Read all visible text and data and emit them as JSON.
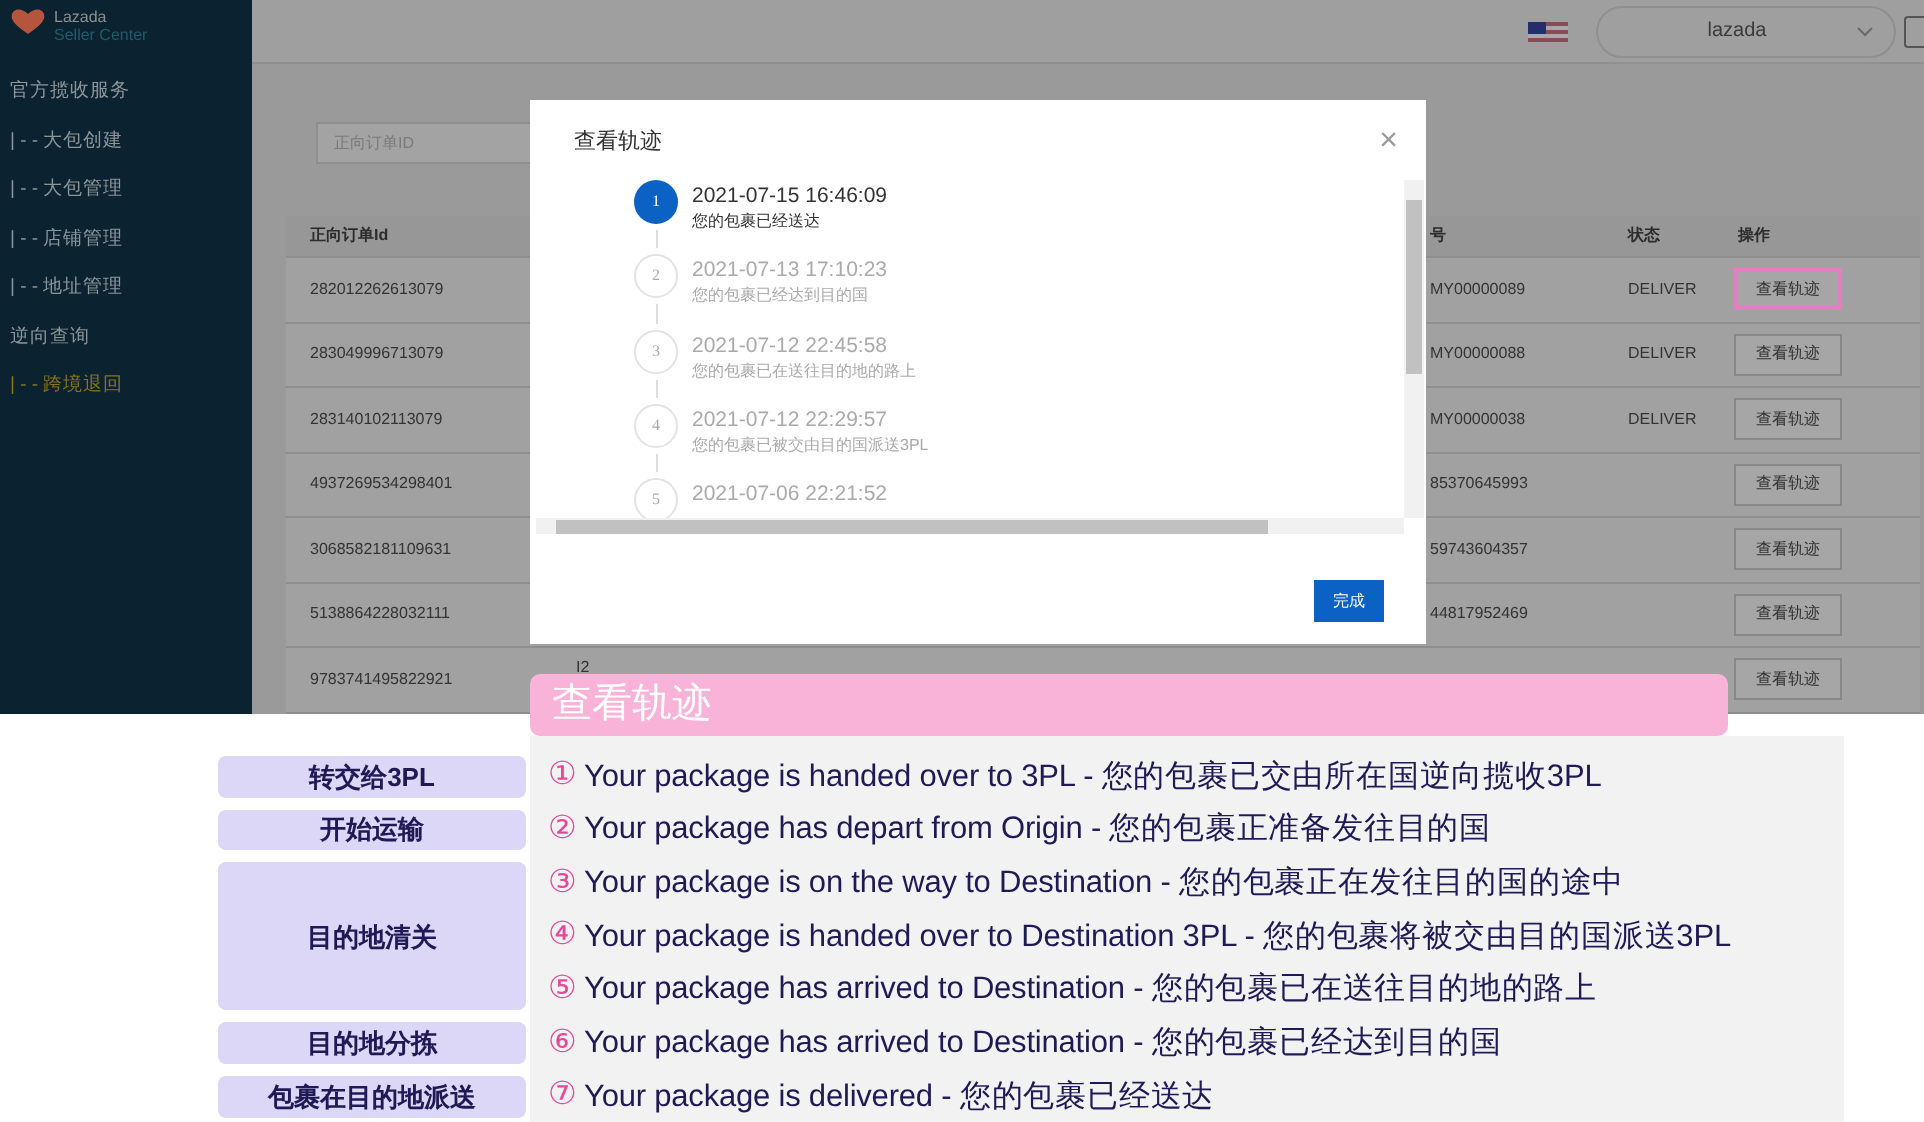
{
  "sidebar": {
    "brand": "Lazada",
    "subtitle": "Seller Center",
    "items": [
      {
        "label": "官方揽收服务",
        "selected": false
      },
      {
        "label": "| - - 大包创建",
        "selected": false
      },
      {
        "label": "| - - 大包管理",
        "selected": false
      },
      {
        "label": "| - - 店铺管理",
        "selected": false
      },
      {
        "label": "| - - 地址管理",
        "selected": false
      },
      {
        "label": "逆向查询",
        "selected": false
      },
      {
        "label": "| - - 跨境退回",
        "selected": true
      }
    ]
  },
  "top_bar": {
    "account": "lazada"
  },
  "search": {
    "placeholder": "正向订单ID"
  },
  "table": {
    "columns": [
      "正向订单Id",
      "号",
      "状态",
      "操作"
    ],
    "rows": [
      {
        "order_id": "282012262613079",
        "column_2": "MY00000089",
        "status": "DELIVER",
        "action": "查看轨迹",
        "highlighted": true
      },
      {
        "order_id": "283049996713079",
        "column_2": "MY00000088",
        "status": "DELIVER",
        "action": "查看轨迹",
        "highlighted": false
      },
      {
        "order_id": "283140102113079",
        "column_2": "MY00000038",
        "status": "DELIVER",
        "action": "查看轨迹",
        "highlighted": false
      },
      {
        "order_id": "4937269534298401",
        "column_2": "85370645993",
        "action": "查看轨迹",
        "highlighted": false
      },
      {
        "order_id": "3068582181109631",
        "column_2": "59743604357",
        "action": "查看轨迹",
        "highlighted": false
      },
      {
        "order_id": "5138864228032111",
        "column_2": "44817952469",
        "action": "查看轨迹",
        "highlighted": false
      },
      {
        "order_id": "9783741495822921",
        "column_1": "I2",
        "action": "查看轨迹",
        "highlighted": false
      }
    ]
  },
  "dialog": {
    "title": "查看轨迹",
    "close": "×",
    "confirm": "完成",
    "steps": [
      {
        "number": "1",
        "time": "2021-07-15 16:46:09",
        "message": "您的包裹已经送达",
        "selected": true
      },
      {
        "number": "2",
        "time": "2021-07-13 17:10:23",
        "message": "您的包裹已经达到目的国",
        "selected": false
      },
      {
        "number": "3",
        "time": "2021-07-12 22:45:58",
        "message": "您的包裹已在送往目的地的路上",
        "selected": false
      },
      {
        "number": "4",
        "time": "2021-07-12 22:29:57",
        "message": "您的包裹已被交由目的国派送3PL",
        "selected": false
      },
      {
        "number": "5",
        "time": "2021-07-06 22:21:52",
        "selected": false
      }
    ]
  },
  "annotation": {
    "title": "查看轨迹",
    "stages": [
      {
        "label": "转交给3PL",
        "steps": [
          {
            "marker": "①",
            "text": "Your package is handed over to 3PL - 您的包裹已交由所在国逆向揽收3PL"
          }
        ]
      },
      {
        "label": "开始运输",
        "steps": [
          {
            "marker": "②",
            "text": "Your package has depart from Origin - 您的包裹正准备发往目的国"
          }
        ]
      },
      {
        "label": "目的地清关",
        "steps": [
          {
            "marker": "③",
            "text": "Your package is on the way to Destination - 您的包裹正在发往目的国的途中"
          },
          {
            "marker": "④",
            "text": "Your package is handed over to Destination 3PL - 您的包裹将被交由目的国派送3PL"
          },
          {
            "marker": "⑤",
            "text": "Your package has arrived to Destination - 您的包裹已在送往目的地的路上"
          }
        ]
      },
      {
        "label": "目的地分拣",
        "steps": [
          {
            "marker": "⑥",
            "text": "Your package has arrived to Destination - 您的包裹已经达到目的国"
          }
        ]
      },
      {
        "label": "包裹在目的地派送",
        "steps": [
          {
            "marker": "⑦",
            "text": "Your package is delivered - 您的包裹已经送达"
          }
        ]
      }
    ]
  }
}
